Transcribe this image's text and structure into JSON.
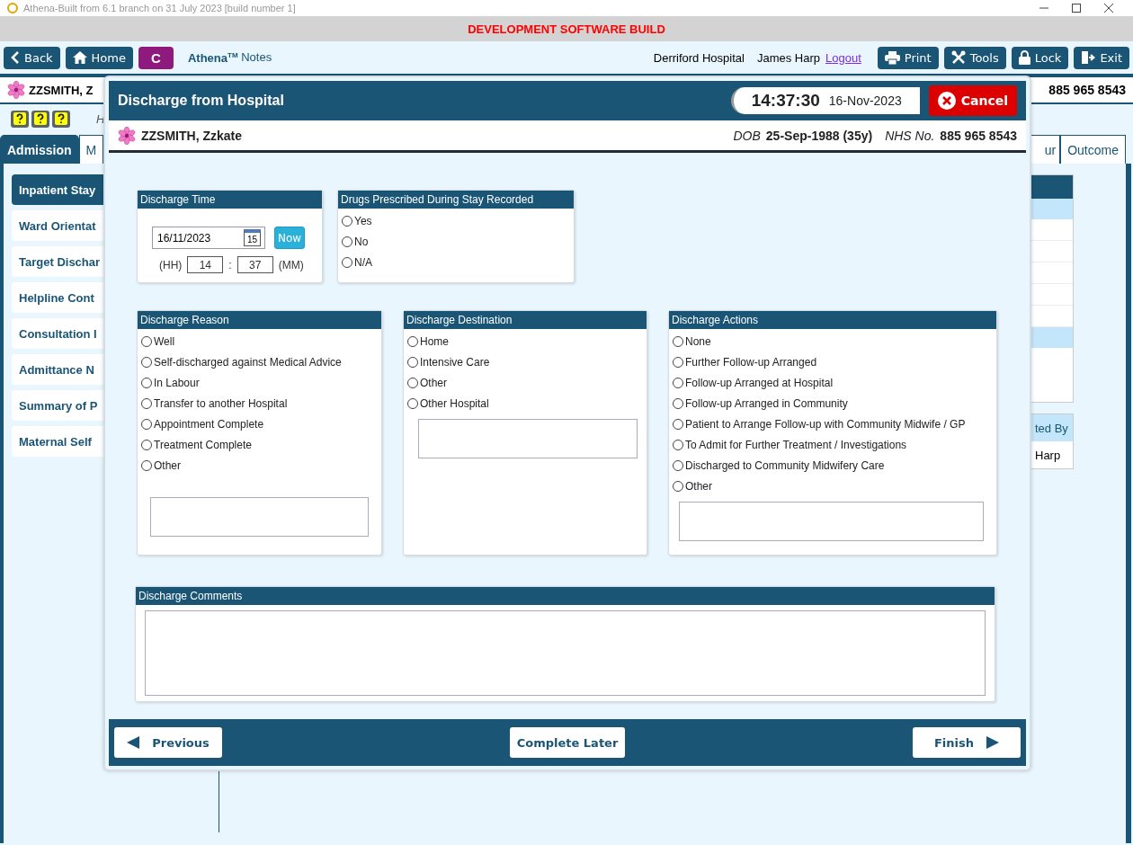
{
  "window": {
    "title": "Athena-Built from 6.1 branch on 31 July 2023 [build number 1]"
  },
  "banner": "DEVELOPMENT SOFTWARE BUILD",
  "nav": {
    "left_buttons": [
      {
        "label": "Back",
        "kind": "back"
      },
      {
        "label": "Home",
        "kind": "home"
      }
    ],
    "app_badge": "C",
    "app_name": "**Athena$^{TM}$** Notes",
    "hospital": "Derriford Hospital",
    "user": "James Harp",
    "logout": "Logout",
    "right_buttons": [
      {
        "label": "Print",
        "kind": "print"
      },
      {
        "label": "Tools",
        "kind": "tools"
      },
      {
        "label": "Lock",
        "kind": "lock"
      },
      {
        "label": "Exit",
        "kind": "exit"
      }
    ]
  },
  "patient_bar": {
    "name": "ZZSMITH, Z",
    "nhs": "885 965 8543"
  },
  "hint": "H",
  "tabs": [
    {
      "label": "Admission",
      "selected": true
    },
    {
      "label": "M",
      "selected": false
    },
    {
      "label": "ur",
      "selected": false
    },
    {
      "label": "Outcome",
      "selected": false
    }
  ],
  "sidebar": {
    "items": [
      {
        "label": "Inpatient Stay",
        "selected": true
      },
      {
        "label": "Ward Orientat",
        "selected": false
      },
      {
        "label": "Target Dischar",
        "selected": false
      },
      {
        "label": "Helpline Cont",
        "selected": false
      },
      {
        "label": "Consultation I",
        "selected": false
      },
      {
        "label": "Admittance N",
        "selected": false
      },
      {
        "label": "Summary of P",
        "selected": false
      },
      {
        "label": "Maternal Self",
        "selected": false
      }
    ]
  },
  "side_table": {
    "header": "ted By",
    "cell": "Harp"
  },
  "dialog": {
    "title": "Discharge from Hospital",
    "time": "14:37:30",
    "date": "16-Nov-2023",
    "cancel": "Cancel",
    "patient": {
      "name": "ZZSMITH, Zzkate",
      "dob_label": "DOB",
      "dob": "25-Sep-1988 (35y)",
      "nhs_label": "NHS No.",
      "nhs": "885 965 8543"
    },
    "discharge_time": {
      "title": "Discharge Time",
      "date": "16/11/2023",
      "calendar_day": "15",
      "now": "Now",
      "hh_label": "(HH)",
      "hh": "14",
      "separator": ":",
      "mm": "37",
      "mm_label": "(MM)"
    },
    "drugs": {
      "title": "Drugs Prescribed During Stay Recorded",
      "options": [
        {
          "label": "Yes",
          "selected": false
        },
        {
          "label": "No",
          "selected": false
        },
        {
          "label": "N/A",
          "selected": false
        }
      ]
    },
    "reason": {
      "title": "Discharge Reason",
      "options": [
        {
          "label": "Well",
          "selected": false
        },
        {
          "label": "Self-discharged against Medical Advice",
          "selected": false
        },
        {
          "label": "In Labour",
          "selected": false
        },
        {
          "label": "Transfer to another Hospital",
          "selected": false
        },
        {
          "label": "Appointment Complete",
          "selected": false
        },
        {
          "label": "Treatment Complete",
          "selected": false
        },
        {
          "label": "Other",
          "selected": false
        }
      ]
    },
    "destination": {
      "title": "Discharge Destination",
      "options": [
        {
          "label": "Home",
          "selected": false
        },
        {
          "label": "Intensive Care",
          "selected": false
        },
        {
          "label": "Other",
          "selected": false
        },
        {
          "label": "Other Hospital",
          "selected": false
        }
      ]
    },
    "actions": {
      "title": "Discharge Actions",
      "options": [
        {
          "label": "None",
          "selected": false
        },
        {
          "label": "Further Follow-up Arranged",
          "selected": false
        },
        {
          "label": "Follow-up Arranged at Hospital",
          "selected": false
        },
        {
          "label": "Follow-up Arranged in Community",
          "selected": false
        },
        {
          "label": "Patient to Arrange Follow-up with Community Midwife / GP",
          "selected": false
        },
        {
          "label": "To Admit for Further Treatment / Investigations",
          "selected": false
        },
        {
          "label": "Discharged to Community Midwifery Care",
          "selected": false
        },
        {
          "label": "Other",
          "selected": false
        }
      ]
    },
    "comments": {
      "title": "Discharge Comments"
    },
    "footer": {
      "previous": "Previous",
      "complete_later": "Complete Later",
      "finish": "Finish"
    }
  }
}
